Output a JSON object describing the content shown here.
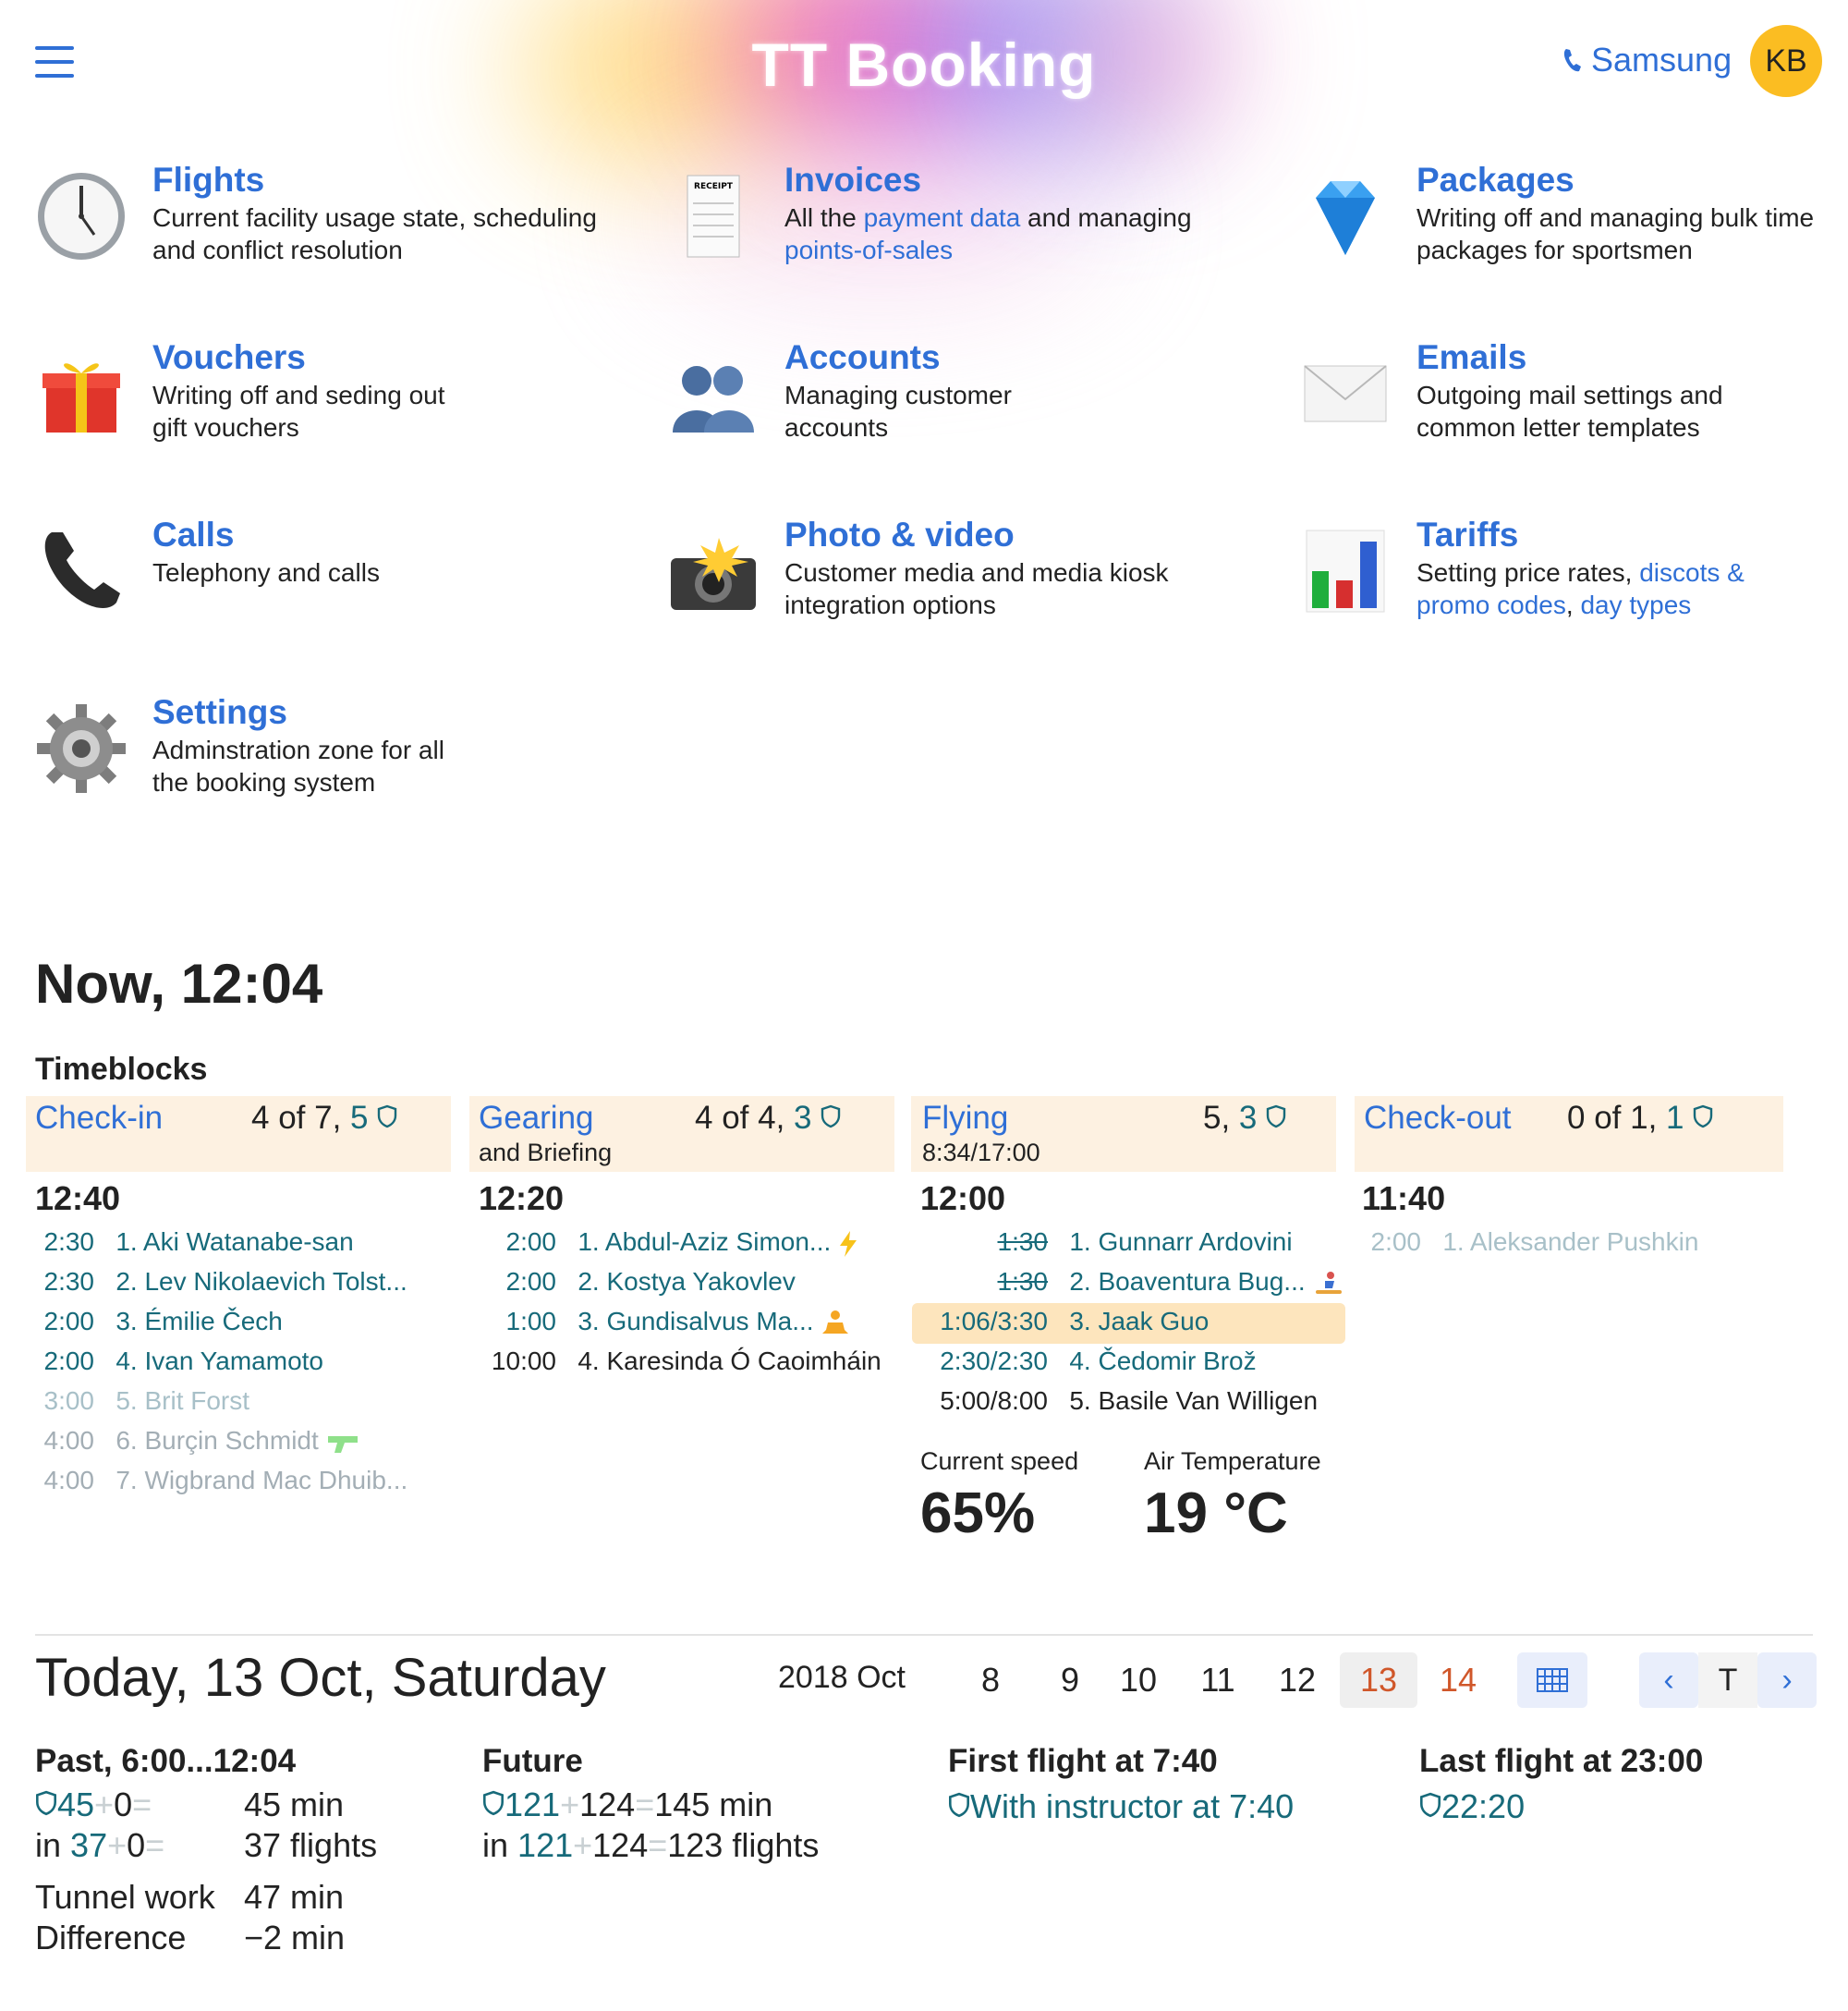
{
  "header": {
    "logo": "TT Booking",
    "org": "Samsung",
    "avatar": "KB"
  },
  "modules": [
    {
      "title": "Flights",
      "desc": "Current facility usage state, scheduling and conflict resolution",
      "icon": "clock-icon"
    },
    {
      "title": "Invoices",
      "d1": "All the ",
      "l1": "payment data",
      "d2": " and managing ",
      "l2": "points-of-sales",
      "icon": "receipt-icon",
      "receipt_label": "RECEIPT"
    },
    {
      "title": "Packages",
      "desc": "Writing off and managing bulk time packages for sportsmen",
      "icon": "gem-icon"
    },
    {
      "title": "Vouchers",
      "desc": "Writing off and seding out gift vouchers",
      "icon": "gift-icon"
    },
    {
      "title": "Accounts",
      "desc": "Managing customer accounts",
      "icon": "users-icon"
    },
    {
      "title": "Emails",
      "desc": "Outgoing mail settings and common letter templates",
      "icon": "envelope-icon"
    },
    {
      "title": "Calls",
      "desc": "Telephony and calls",
      "icon": "phone-icon"
    },
    {
      "title": "Photo & video",
      "desc": "Customer media and media kiosk integration options",
      "icon": "camera-flash-icon"
    },
    {
      "title": "Tariffs",
      "d1": "Setting price rates, ",
      "l1": "discots & promo codes",
      "d2": ", ",
      "l2": "day types",
      "icon": "bar-chart-icon"
    },
    {
      "title": "Settings",
      "desc": "Adminstration zone for all the booking system",
      "icon": "gear-icon"
    }
  ],
  "now": {
    "title": "Now, 12:04",
    "timeblocks_label": "Timeblocks",
    "columns": [
      {
        "name": "Check-in",
        "sub": "",
        "count": "4 of 7, ",
        "inst": "5",
        "time": "12:40",
        "rows": [
          {
            "d": "2:30",
            "n": "1. Aki Watanabe-san",
            "s": "teal"
          },
          {
            "d": "2:30",
            "n": "2. Lev Nikolaevich Tolst...",
            "s": "teal"
          },
          {
            "d": "2:00",
            "n": "3. Émilie Čech",
            "s": "teal"
          },
          {
            "d": "2:00",
            "n": "4. Ivan Yamamoto",
            "s": "teal"
          },
          {
            "d": "3:00",
            "n": "5. Brit Forst",
            "s": "faded"
          },
          {
            "d": "4:00",
            "n": "6. Burçin Schmidt",
            "s": "gray"
          },
          {
            "d": "4:00",
            "n": "7. Wigbrand Mac Dhuib...",
            "s": "gray"
          }
        ]
      },
      {
        "name": "Gearing",
        "sub": "and Briefing",
        "count": "4 of 4, ",
        "inst": "3",
        "time": "12:20",
        "rows": [
          {
            "d": "2:00",
            "n": "1. Abdul-Aziz Simon...",
            "s": "teal"
          },
          {
            "d": "2:00",
            "n": "2. Kostya Yakovlev",
            "s": "teal"
          },
          {
            "d": "1:00",
            "n": "3. Gundisalvus Ma...",
            "s": "teal"
          },
          {
            "d": "10:00",
            "n": "4. Karesinda Ó Caoimháin",
            "s": "dark"
          }
        ]
      },
      {
        "name": "Flying",
        "sub": "8:34/17:00",
        "count": "5, ",
        "inst": "3",
        "time": "12:00",
        "rows": [
          {
            "d": "1:30",
            "n": "1. Gunnarr Ardovini",
            "s": "teal"
          },
          {
            "d": "1:30",
            "n": "2. Boaventura Bug...",
            "s": "teal"
          },
          {
            "d": "1:06/3:30",
            "n": "3. Jaak Guo",
            "s": "teal"
          },
          {
            "d": "2:30/2:30",
            "n": "4. Čedomir Brož",
            "s": "teal"
          },
          {
            "d": "5:00/8:00",
            "n": "5. Basile Van Willigen",
            "s": "dark"
          }
        ]
      },
      {
        "name": "Check-out",
        "sub": "",
        "count": "0 of 1, ",
        "inst": "1",
        "time": "11:40",
        "rows": [
          {
            "d": "2:00",
            "n": "1. Aleksander Pushkin",
            "s": "faded"
          }
        ]
      }
    ],
    "speed_label": "Current speed",
    "speed_value": "65%",
    "temp_label": "Air Temperature",
    "temp_value": "19 °C"
  },
  "today": {
    "title": "Today, 13 Oct, Saturday",
    "year_month": "2018 Oct",
    "days": [
      "8",
      "9",
      "10",
      "11",
      "12",
      "13",
      "14"
    ],
    "nav_today": "T",
    "nav_prev": "‹",
    "nav_next": "›",
    "past": {
      "label": "Past, 6:00...12:04",
      "r1a": "45",
      "r1b": "0",
      "r1c": "45 min",
      "r2p": "in",
      "r2a": "37",
      "r2b": "0",
      "r2c": "37 flights",
      "tw_label": "Tunnel work",
      "tw_value": "47 min",
      "diff_label": "Difference",
      "diff_value": "−2 min"
    },
    "future": {
      "label": "Future",
      "r1a": "121",
      "r1b": "124",
      "r1c": "145 min",
      "r2p": "in",
      "r2a": "121",
      "r2b": "124",
      "r2c": "123 flights"
    },
    "first": {
      "label": "First flight at 7:40",
      "value": "With instructor at 7:40"
    },
    "last": {
      "label": "Last flight at 23:00",
      "value": "22:20"
    },
    "op_plus": "+",
    "op_eq": "="
  },
  "colors": {
    "link": "#2f6fd6",
    "teal": "#176a7a",
    "accent": "#fbbd22",
    "weekend": "#d0572a",
    "band": "#fdf1e1"
  }
}
